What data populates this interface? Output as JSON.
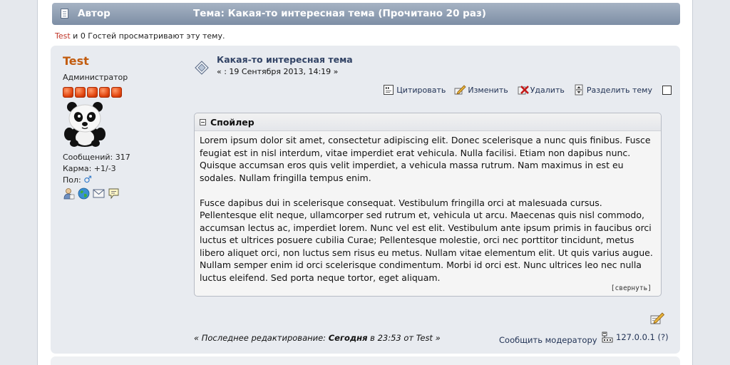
{
  "header": {
    "author_label": "Автор",
    "topic_title": "Тема: Какая-то интересная тема  (Прочитано 20 раз)"
  },
  "viewers": {
    "user": "Test",
    "text": " и 0 Гостей просматривают эту тему."
  },
  "post": {
    "poster": {
      "name": "Test",
      "group": "Администратор",
      "stars": 5,
      "posts": "Сообщений: 317",
      "karma": "Карма: +1/-3",
      "gender_label": "Пол:",
      "gender_symbol": "♂",
      "avatar_icon": "panda-avatar",
      "icons": [
        "profile-icon",
        "website-icon",
        "email-icon",
        "pm-icon"
      ]
    },
    "subject": "Какая-то интересная тема",
    "date": "« : 19 Сентября 2013, 14:19 »",
    "actions": {
      "quote": "Цитировать",
      "modify": "Изменить",
      "delete": "Удалить",
      "split": "Разделить тему"
    },
    "spoiler": {
      "title": "Спойлер",
      "paragraph1": "Lorem ipsum dolor sit amet, consectetur adipiscing elit. Donec scelerisque a nunc quis finibus. Fusce feugiat est in nisl interdum, vitae imperdiet erat vehicula. Nulla facilisi. Etiam non dapibus nunc. Quisque accumsan eros quis velit imperdiet, a vehicula massa rutrum. Nam maximus in est eu sodales. Nullam fringilla tempus enim.",
      "paragraph2": "Fusce dapibus dui in scelerisque consequat. Vestibulum fringilla orci at malesuada cursus. Pellentesque elit neque, ullamcorper sed rutrum et, vehicula ut arcu. Maecenas quis nisl commodo, accumsan lectus ac, imperdiet lorem. Nunc vel est elit. Vestibulum ante ipsum primis in faucibus orci luctus et ultrices posuere cubilia Curae; Pellentesque molestie, orci nec porttitor tincidunt, metus libero aliquet orci, non luctus sem risus eu metus. Nullam vitae elementum elit. Ut quis varius augue. Nullam semper enim id orci scelerisque condimentum. Morbi id orci est. Nunc ultrices leo nec nulla luctus eleifend. Sed porta neque tortor, eget aliquam.",
      "collapse_label": "[свернуть]"
    },
    "edited": {
      "prefix": "« Последнее редактирование: ",
      "when": "Сегодня",
      "suffix": " в 23:53 от Test »"
    },
    "report_label": "Сообщить модератору",
    "ip": "127.0.0.1 (?)"
  },
  "colors": {
    "header_bar": "#8c9bb0",
    "post_bg": "#e8ebf0",
    "poster_name": "#c25c0f",
    "link": "#223355"
  }
}
